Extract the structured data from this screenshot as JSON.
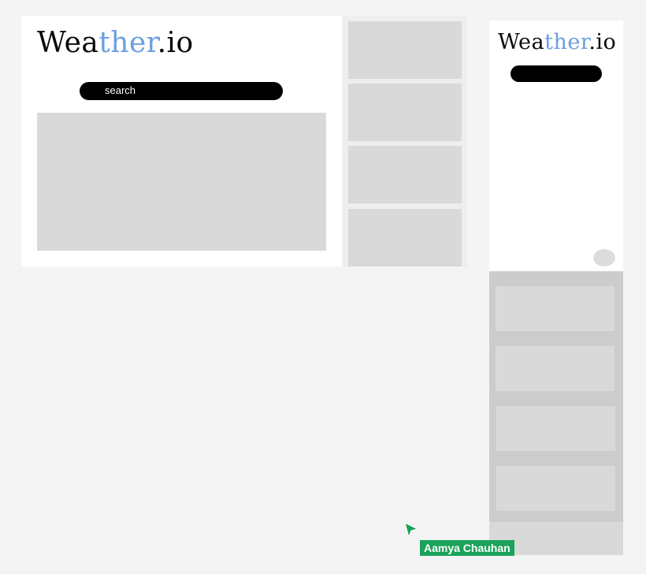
{
  "desktop": {
    "logo": {
      "part1": "Wea",
      "accent": "ther",
      "part2": ".io"
    },
    "search": {
      "placeholder": "search"
    }
  },
  "mobile": {
    "logo": {
      "part1": "Wea",
      "accent": "ther",
      "part2": ".io"
    }
  },
  "collaborator": {
    "name": "Aamya Chauhan",
    "color": "#1aa35a"
  },
  "colors": {
    "accent": "#6a9fe0",
    "placeholder": "#d9d9d9",
    "background": "#f4f4f4"
  }
}
